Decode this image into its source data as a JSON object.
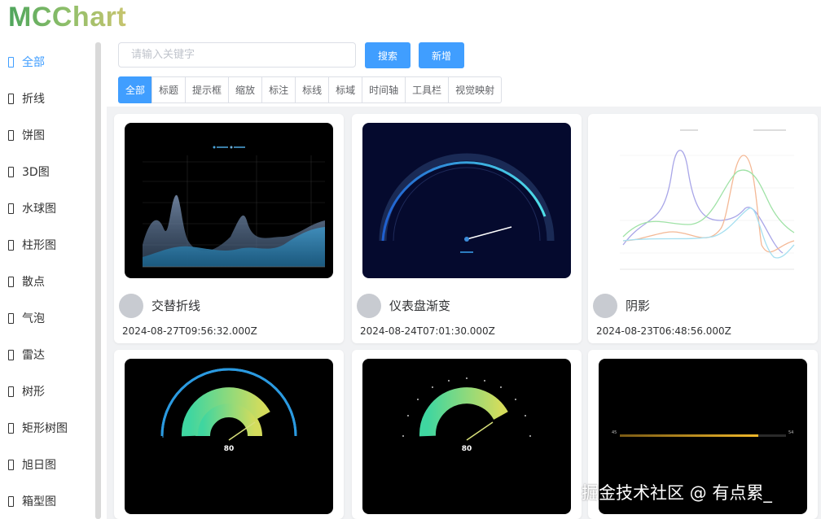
{
  "logo": "MCChart",
  "sidebar": {
    "items": [
      {
        "label": "全部",
        "active": true
      },
      {
        "label": "折线"
      },
      {
        "label": "饼图"
      },
      {
        "label": "3D图"
      },
      {
        "label": "水球图"
      },
      {
        "label": "柱形图"
      },
      {
        "label": "散点"
      },
      {
        "label": "气泡"
      },
      {
        "label": "雷达"
      },
      {
        "label": "树形"
      },
      {
        "label": "矩形树图"
      },
      {
        "label": "旭日图"
      },
      {
        "label": "箱型图"
      }
    ]
  },
  "search": {
    "placeholder": "请输入关键字",
    "value": ""
  },
  "buttons": {
    "search": "搜索",
    "add": "新增"
  },
  "tabs": [
    "全部",
    "标题",
    "提示框",
    "缩放",
    "标注",
    "标线",
    "标域",
    "时间轴",
    "工具栏",
    "视觉映射"
  ],
  "active_tab": "全部",
  "cards": [
    {
      "title": "交替折线",
      "date": "2024-08-27T09:56:32.000Z",
      "preview": "area-chart-dark"
    },
    {
      "title": "仪表盘渐变",
      "date": "2024-08-24T07:01:30.000Z",
      "preview": "gauge-navy"
    },
    {
      "title": "阴影",
      "date": "2024-08-23T06:48:56.000Z",
      "preview": "curve-chart-light"
    },
    {
      "title": "",
      "date": "",
      "preview": "gauge-ring"
    },
    {
      "title": "",
      "date": "",
      "preview": "gauge-ticks"
    },
    {
      "title": "",
      "date": "",
      "preview": "progress-line"
    }
  ],
  "previews": {
    "gauge_ring_value": "80",
    "gauge_ticks_value": "80",
    "progress_left": "45",
    "progress_right": "54"
  },
  "watermark": "掘金技术社区 @ 有点累_",
  "colors": {
    "accent": "#409eff",
    "avatar": "#c8cbd1",
    "card_bg": "#f1f2f4"
  },
  "icons": {
    "sidebar_item": "bracket-square-icon"
  }
}
